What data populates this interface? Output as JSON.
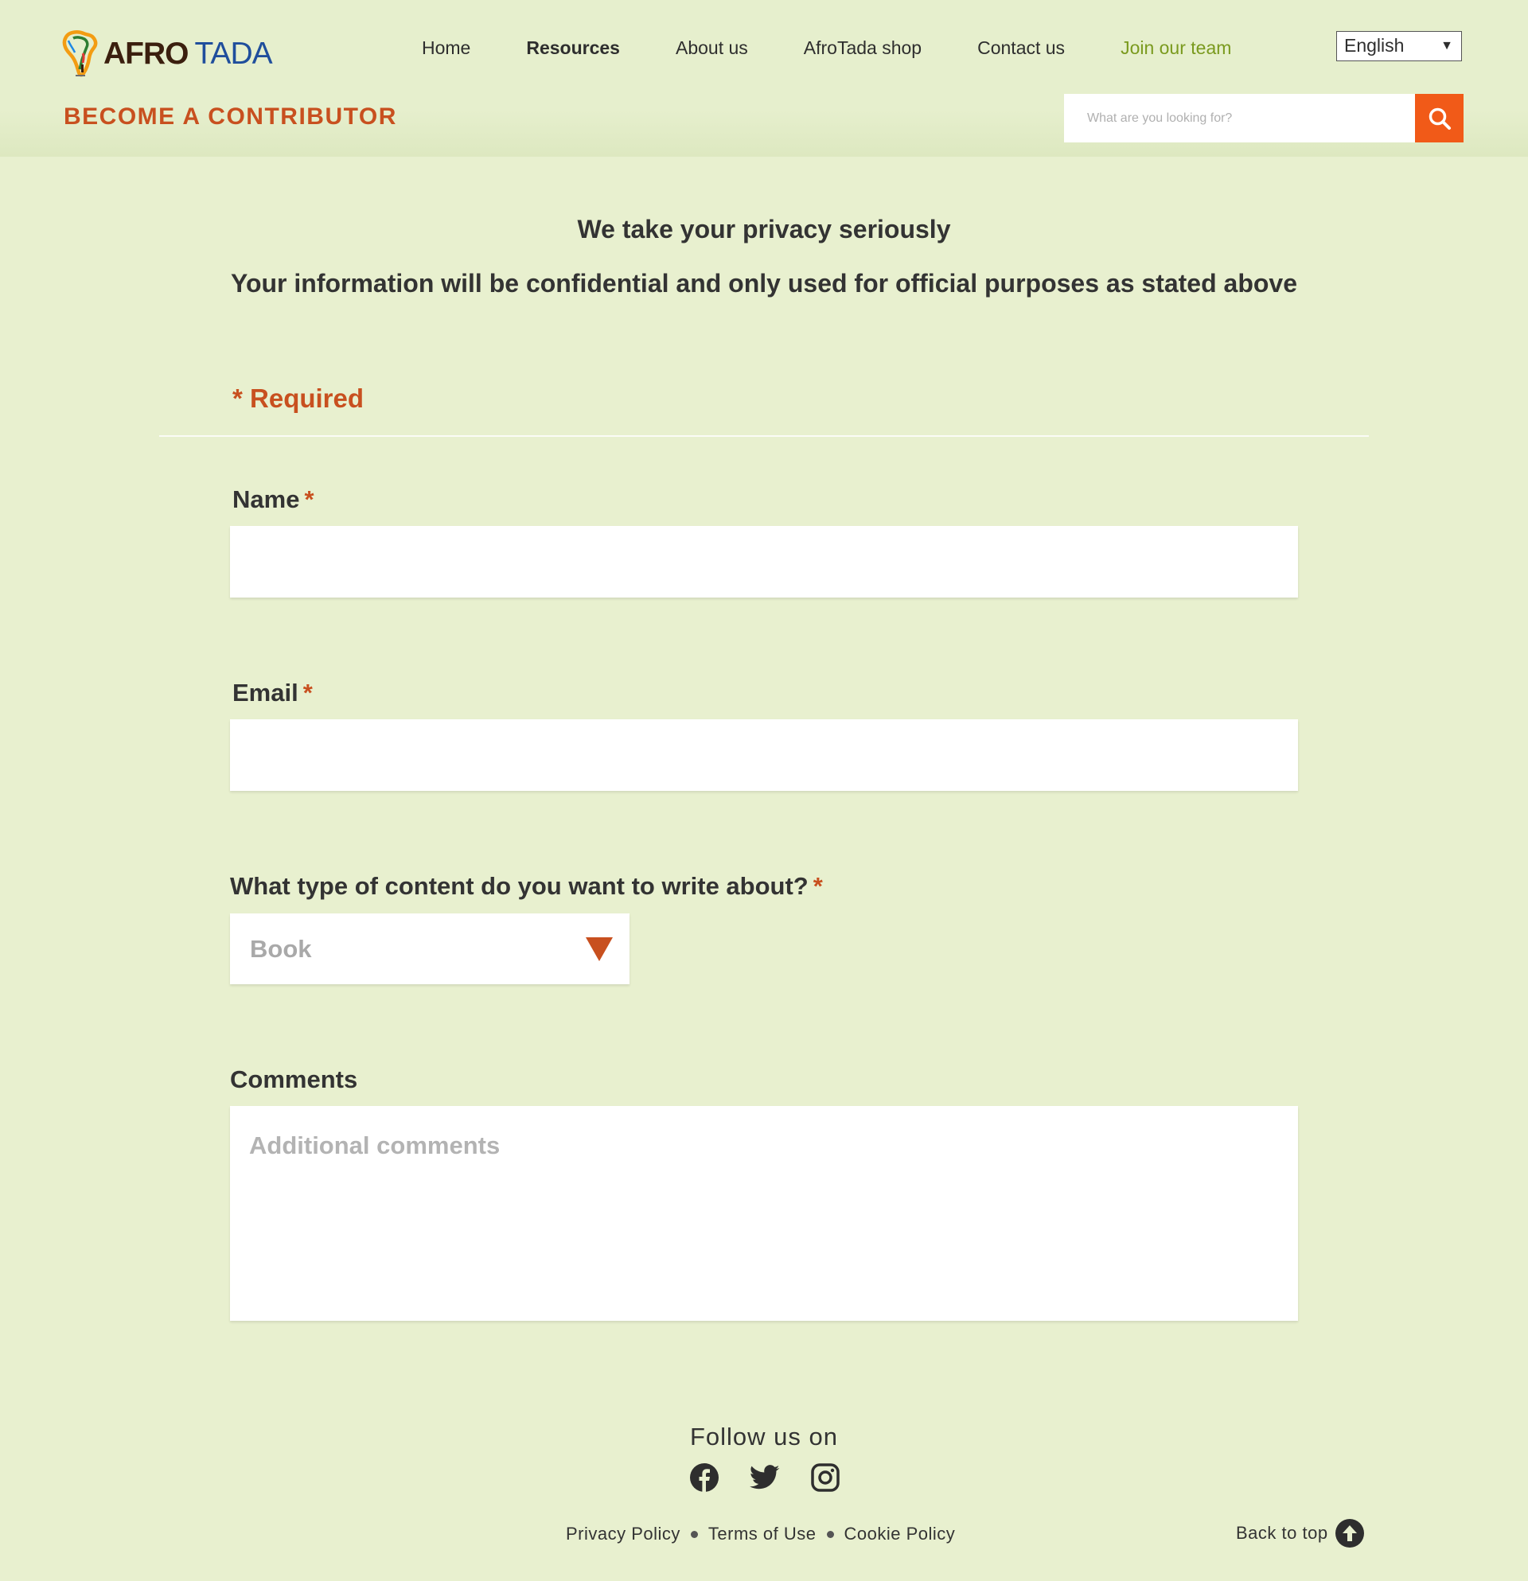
{
  "header": {
    "logo": {
      "part1": "AFRO",
      "part2": "TADA"
    },
    "nav": [
      {
        "label": "Home"
      },
      {
        "label": "Resources"
      },
      {
        "label": "About us"
      },
      {
        "label": "AfroTada shop"
      },
      {
        "label": "Contact us"
      },
      {
        "label": "Join our team"
      }
    ],
    "language": "English",
    "page_heading": "BECOME A CONTRIBUTOR",
    "search": {
      "placeholder": "What are you looking for?",
      "button_icon": "search-icon"
    }
  },
  "privacy": {
    "title": "We take your privacy seriously",
    "subtitle": "Your information will be confidential and only used for official purposes as stated above"
  },
  "form": {
    "required_note": "* Required",
    "name": {
      "label": "Name",
      "star": "*",
      "value": ""
    },
    "email": {
      "label": "Email",
      "star": "*",
      "value": ""
    },
    "content_type": {
      "label": "What type of content do you want to write about?",
      "star": "*",
      "selected": "Book"
    },
    "comments": {
      "label": "Comments",
      "placeholder": "Additional comments"
    }
  },
  "footer": {
    "follow": "Follow us on",
    "social": [
      "facebook-icon",
      "twitter-icon",
      "instagram-icon"
    ],
    "links": [
      "Privacy Policy",
      "Terms of Use",
      "Cookie Policy"
    ],
    "back_to_top": "Back to top"
  },
  "colors": {
    "background": "#e8f0cf",
    "accent_orange": "#c8501f",
    "search_button": "#f15a18",
    "join_green": "#7a9a1e",
    "logo_brown": "#3b1f0e",
    "logo_blue": "#1f4e9c"
  }
}
